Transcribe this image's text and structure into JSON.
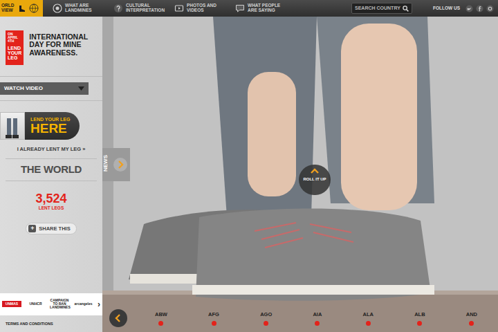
{
  "nav": {
    "home": {
      "label": "ORLD VIEW",
      "selected": true
    },
    "items": [
      {
        "label": "WHAT ARE LANDMINES",
        "selected": false
      },
      {
        "label": "CULTURAL INTERPRETATION",
        "selected": false
      },
      {
        "label": "PHOTOS AND VIDEOS",
        "selected": false
      },
      {
        "label": "WHAT PEOPLE ARE SAYING",
        "selected": false
      }
    ]
  },
  "search": {
    "placeholder": "SEARCH COUNTRY"
  },
  "follow": {
    "label": "FOLLOW US"
  },
  "sidebar": {
    "logo": {
      "small": "ON APRIL 4TH",
      "big": "LEND YOUR LEG"
    },
    "title": "INTERNATIONAL DAY FOR MINE AWARENESS.",
    "video": {
      "label": "WATCH VIDEO",
      "expanded": false
    },
    "lend": {
      "line1": "LEND YOUR LEG",
      "line2": "HERE"
    },
    "already": "I ALREADY LENT MY LEG »",
    "region": "THE WORLD",
    "count": "3,524",
    "count_label": "LENT LEGS",
    "share": {
      "icon": "+",
      "label": "SHARE THIS"
    },
    "partners": [
      "UNMAS",
      "UNHCR",
      "CAMPAIGN TO BAN LANDMINES",
      "arcangeles"
    ],
    "partners_next": "›",
    "terms": "TERMS AND CONDITIONS"
  },
  "news": {
    "label": "NEWS"
  },
  "roll": {
    "label": "ROLL IT UP"
  },
  "timeline": {
    "countries": [
      "ABW",
      "AFG",
      "AGO",
      "AIA",
      "ALA",
      "ALB",
      "AND"
    ]
  }
}
